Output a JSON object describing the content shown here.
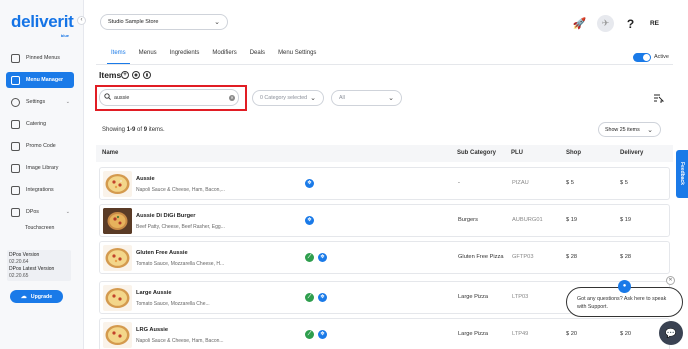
{
  "brand": {
    "name": "deliverit",
    "sub": "blue",
    "color": "#1a7ae8"
  },
  "sidebar": {
    "items": [
      {
        "label": "Pinned Menus",
        "icon": "pin-icon"
      },
      {
        "label": "Menu Manager",
        "icon": "menu-manager-icon"
      },
      {
        "label": "Settings",
        "icon": "gear-icon"
      },
      {
        "label": "Catering",
        "icon": "catering-icon"
      },
      {
        "label": "Promo Code",
        "icon": "promo-icon"
      },
      {
        "label": "Image Library",
        "icon": "image-icon"
      },
      {
        "label": "Integrations",
        "icon": "integrations-icon"
      },
      {
        "label": "DPos",
        "icon": "pos-icon"
      }
    ],
    "sub_item": "Touchscreen",
    "version": {
      "label": "DPos Version",
      "value": "02.20.64",
      "latest_label": "DPos Latest Version",
      "latest_value": "02.20.65"
    },
    "upgrade_label": "Upgrade"
  },
  "header": {
    "store": "Studio Sample Store",
    "avatar_initials": "RE"
  },
  "tabs": [
    "Items",
    "Menus",
    "Ingredients",
    "Modifiers",
    "Deals",
    "Menu Settings"
  ],
  "active_label": "Active",
  "items_title": "Items",
  "search": {
    "value": "aussie"
  },
  "filters": {
    "category": "0 Category selected",
    "status": "All"
  },
  "showing": {
    "prefix": "Showing ",
    "range": "1-9",
    "mid": " of ",
    "total": "9",
    "suffix": " items."
  },
  "page_size": "Show 25 items",
  "columns": {
    "name": "Name",
    "sub_category": "Sub Category",
    "plu": "PLU",
    "shop": "Shop",
    "delivery": "Delivery"
  },
  "rows": [
    {
      "name": "Aussie",
      "desc": "Napoli Sauce & Cheese, Ham, Bacon,...",
      "sub_category": "-",
      "plu": "PIZAU",
      "shop": "$ 5",
      "delivery": "$ 5",
      "green": false
    },
    {
      "name": "Aussie Di DiGi Burger",
      "desc": "Beef Patty, Cheese, Beef Rasher, Egg...",
      "sub_category": "Burgers",
      "plu": "AUBURG01",
      "shop": "$ 19",
      "delivery": "$ 19",
      "green": false
    },
    {
      "name": "Gluten Free Aussie",
      "desc": "Tomato Sauce, Mozzarella Cheese, H...",
      "sub_category": "Gluten Free Pizza",
      "plu": "GFTP03",
      "shop": "$ 28",
      "delivery": "$ 28",
      "green": true
    },
    {
      "name": "Large Aussie",
      "desc": "Tomato Sauce, Mozzarella Che...",
      "sub_category": "Large Pizza",
      "plu": "LTP03",
      "shop": "",
      "delivery": "",
      "green": true
    },
    {
      "name": "LRG Aussie",
      "desc": "Napoli Sauce & Cheese, Ham, Bacon...",
      "sub_category": "Large Pizza",
      "plu": "LTP49",
      "shop": "$ 20",
      "delivery": "$ 20",
      "green": true
    }
  ],
  "feedback_label": "Feedback",
  "chat": {
    "message": "Got any questions? Ask here to speak with Support."
  }
}
